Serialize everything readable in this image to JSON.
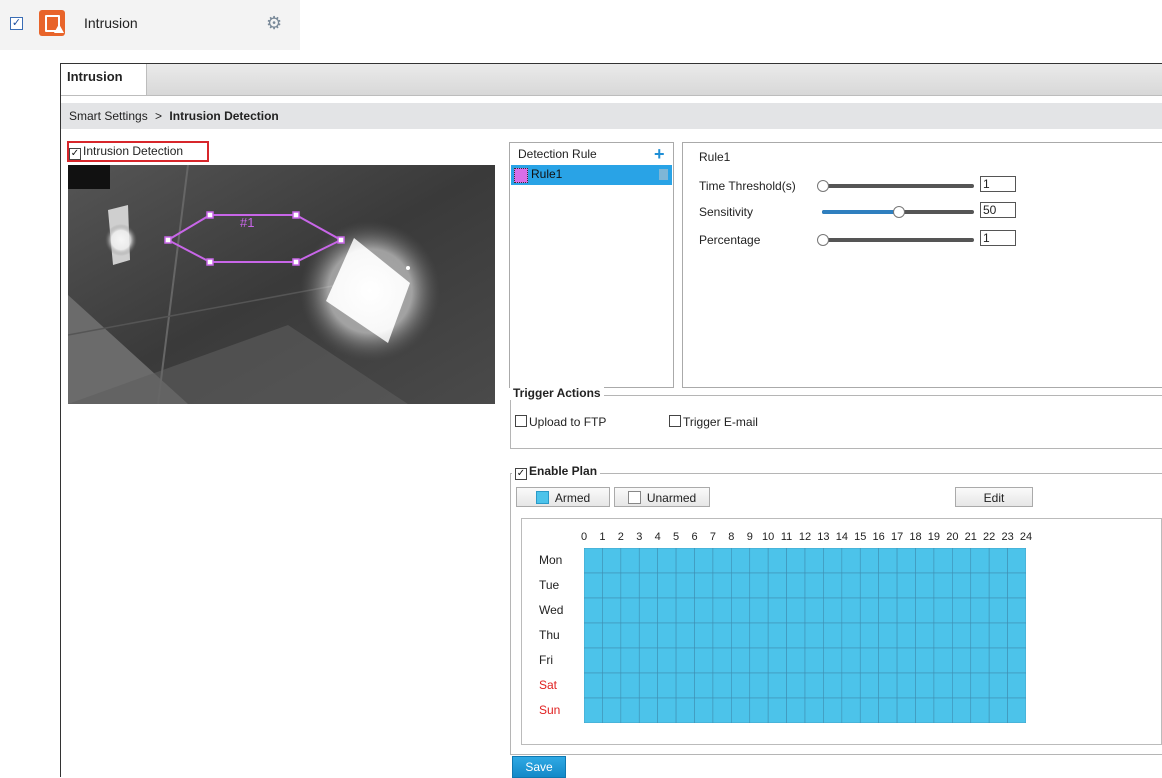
{
  "top": {
    "checked": true,
    "title": "Intrusion"
  },
  "tab": {
    "label": "Intrusion"
  },
  "breadcrumb": {
    "parent": "Smart Settings",
    "separator": ">",
    "current": "Intrusion Detection"
  },
  "detection": {
    "label": "Intrusion Detection",
    "enabled": true
  },
  "video": {
    "zone_label": "#1"
  },
  "rule_list": {
    "header": "Detection Rule",
    "rules": [
      {
        "name": "Rule1",
        "color": "#d86ee8",
        "selected": true
      }
    ]
  },
  "rule_params": {
    "title": "Rule1",
    "params": [
      {
        "label": "Time Threshold(s)",
        "value": "1",
        "level": 0.0
      },
      {
        "label": "Sensitivity",
        "value": "50",
        "level": 0.5
      },
      {
        "label": "Percentage",
        "value": "1",
        "level": 0.0
      }
    ]
  },
  "trigger_actions": {
    "legend": "Trigger Actions",
    "options": [
      {
        "label": "Upload to FTP",
        "checked": false
      },
      {
        "label": "Trigger E-mail",
        "checked": false
      }
    ]
  },
  "plan": {
    "legend": "Enable Plan",
    "enabled": true,
    "armed_label": "Armed",
    "unarmed_label": "Unarmed",
    "edit_label": "Edit",
    "hours": [
      "0",
      "1",
      "2",
      "3",
      "4",
      "5",
      "6",
      "7",
      "8",
      "9",
      "10",
      "11",
      "12",
      "13",
      "14",
      "15",
      "16",
      "17",
      "18",
      "19",
      "20",
      "21",
      "22",
      "23",
      "24"
    ],
    "days": [
      {
        "label": "Mon",
        "weekend": false
      },
      {
        "label": "Tue",
        "weekend": false
      },
      {
        "label": "Wed",
        "weekend": false
      },
      {
        "label": "Thu",
        "weekend": false
      },
      {
        "label": "Fri",
        "weekend": false
      },
      {
        "label": "Sat",
        "weekend": true
      },
      {
        "label": "Sun",
        "weekend": true
      }
    ],
    "armed_color": "#4cc3ea",
    "weekend_color": "#e02020"
  },
  "save_label": "Save"
}
